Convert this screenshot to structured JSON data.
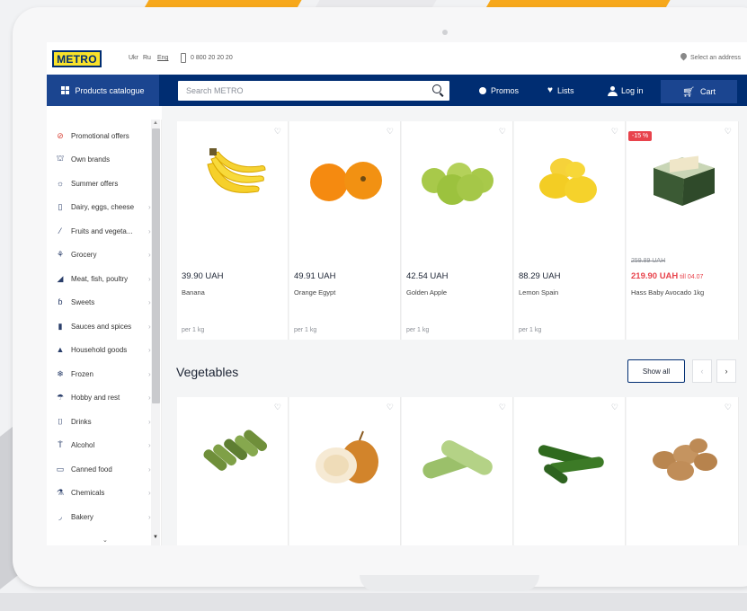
{
  "header": {
    "logo_text": "METRO",
    "languages": [
      "Ukr",
      "Ru",
      "Eng"
    ],
    "active_language": "Eng",
    "phone": "0 800 20 20 20",
    "address_label": "Select an address"
  },
  "nav": {
    "catalogue_label": "Products catalogue",
    "search_placeholder": "Search METRO",
    "promos_label": "Promos",
    "lists_label": "Lists",
    "login_label": "Log in",
    "cart_label": "Cart"
  },
  "sidebar": {
    "items": [
      {
        "label": "Promotional offers",
        "icon": "promo-icon"
      },
      {
        "label": "Own brands",
        "icon": "basket-icon"
      },
      {
        "label": "Summer offers",
        "icon": "sun-icon"
      },
      {
        "label": "Dairy, eggs, cheese",
        "icon": "milk-icon"
      },
      {
        "label": "Fruits and vegeta...",
        "icon": "carrot-icon"
      },
      {
        "label": "Grocery",
        "icon": "grain-icon"
      },
      {
        "label": "Meat, fish, poultry",
        "icon": "meat-icon"
      },
      {
        "label": "Sweets",
        "icon": "candy-icon"
      },
      {
        "label": "Sauces and spices",
        "icon": "bottle-icon"
      },
      {
        "label": "Household goods",
        "icon": "house-icon"
      },
      {
        "label": "Frozen",
        "icon": "snowflake-icon"
      },
      {
        "label": "Hobby and rest",
        "icon": "umbrella-icon"
      },
      {
        "label": "Drinks",
        "icon": "cup-icon"
      },
      {
        "label": "Alcohol",
        "icon": "glass-icon"
      },
      {
        "label": "Canned food",
        "icon": "can-icon"
      },
      {
        "label": "Chemicals",
        "icon": "spray-icon"
      },
      {
        "label": "Bakery",
        "icon": "bread-icon"
      }
    ]
  },
  "products": [
    {
      "name": "Banana",
      "price": "39.90 UAH",
      "unit": "per 1 kg"
    },
    {
      "name": "Orange Egypt",
      "price": "49.91 UAH",
      "unit": "per 1 kg"
    },
    {
      "name": "Golden Apple",
      "price": "42.54 UAH",
      "unit": "per 1 kg"
    },
    {
      "name": "Lemon Spain",
      "price": "88.29 UAH",
      "unit": "per 1 kg"
    },
    {
      "name": "Hass Baby Avocado 1kg",
      "price": "219.90 UAH",
      "old_price": "259.89 UAH",
      "till": "till 04.07",
      "badge": "-15 %"
    }
  ],
  "vegetables": {
    "title": "Vegetables",
    "show_all": "Show all",
    "items": [
      "gherkin",
      "onion",
      "zucchini",
      "cucumber",
      "potato"
    ]
  }
}
